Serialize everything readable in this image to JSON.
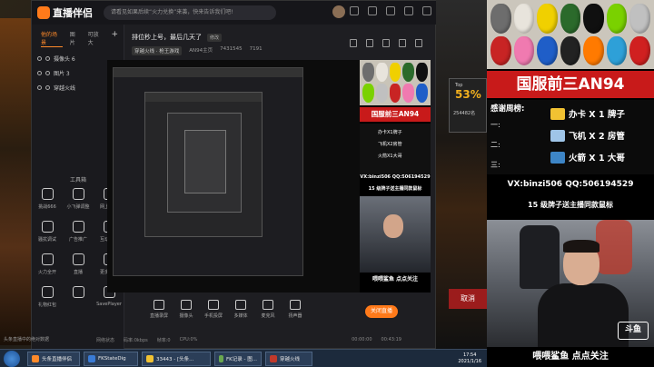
{
  "app": {
    "name": "直播伴侣",
    "notice": "请看见如果后续“火力兑换”来袭，快来告诉我们吧!"
  },
  "left_panel": {
    "tabs": [
      "他的场景",
      "图片",
      "可放大"
    ],
    "add": "+",
    "sources": [
      "摄像头 6",
      "图片 3",
      "穿越火线"
    ],
    "tools_title": "工具箱",
    "tools": [
      "挑战666",
      "小飞弹调整",
      "网上关注",
      "骚扰调试",
      "广告推广",
      "互动任务",
      "火力全开",
      "直播",
      "更多功能",
      "礼物红包",
      "",
      "SavePlayer"
    ],
    "status": "头条直播中的绝对数据"
  },
  "preview_head": {
    "title": "排位秒上号，最后几天了",
    "edit": "修改",
    "category": "穿越火线 · 枪王游戏",
    "meta": [
      "AN94主页",
      "7431545",
      "7191"
    ]
  },
  "bottom_tools": [
    "直播录屏",
    "摄像头",
    "手机投屏",
    "多媒体",
    "麦克风",
    "扬声器"
  ],
  "go_live": "关闭直播",
  "status_row": [
    "网络状态",
    "码率:0kbps",
    "帧率:0",
    "CPU:0%",
    "00:00:00",
    "00:43:19"
  ],
  "overlay": {
    "title": "国服前三AN94",
    "thanks_header": "感谢周榜:",
    "ranks": [
      "一:",
      "二:",
      "三:"
    ],
    "prizes": [
      {
        "text": "办卡 X 1 牌子",
        "color": "#f1c232"
      },
      {
        "text": "飞机 X 2 房管",
        "color": "#9fc5e8"
      },
      {
        "text": "火箭 X 1 大哥",
        "color": "#3d85c6"
      }
    ],
    "vx": "VX:binzi506  QQ:506194529",
    "gift": "15 级牌子送主播同款鼠标",
    "caption": "喂喂鲨鱼   点点关注",
    "douyu": "斗鱼",
    "mini_thanks": [
      "办卡X1牌子",
      "飞机X2房管",
      "火箭X1大哥"
    ],
    "mini_vx": "VX:binzi506  QQ:506194529",
    "mini_gift": "15 级牌子送主播同款鼠标",
    "mini_caption": "喂喂鲨鱼   点点关注"
  },
  "mouse_colors": [
    "#6d6d6d",
    "#e8e4dc",
    "#f0d000",
    "#2b6a2b",
    "#101010",
    "#7ad100",
    "#c0c0c0",
    "#c82424",
    "#f07ab0",
    "#1f5ec8",
    "#222",
    "#ff7a00",
    "#2ea0d8",
    "#d02020"
  ],
  "game": {
    "rank_label": "Top",
    "rank_pct": "53%",
    "rank_num": "254482名",
    "cancel": "取消"
  },
  "taskbar": {
    "items": [
      {
        "label": "头条直播伴侣",
        "color": "#ff8a2a"
      },
      {
        "label": "FKStateDig",
        "color": "#3a7bd5"
      },
      {
        "label": "33443 - [头条...",
        "color": "#f1c232"
      },
      {
        "label": "FK记录 - 图...",
        "color": "#6aa84f"
      },
      {
        "label": "穿越火线",
        "color": "#c0392b"
      }
    ],
    "time": "17:54",
    "date": "2021/1/16"
  }
}
